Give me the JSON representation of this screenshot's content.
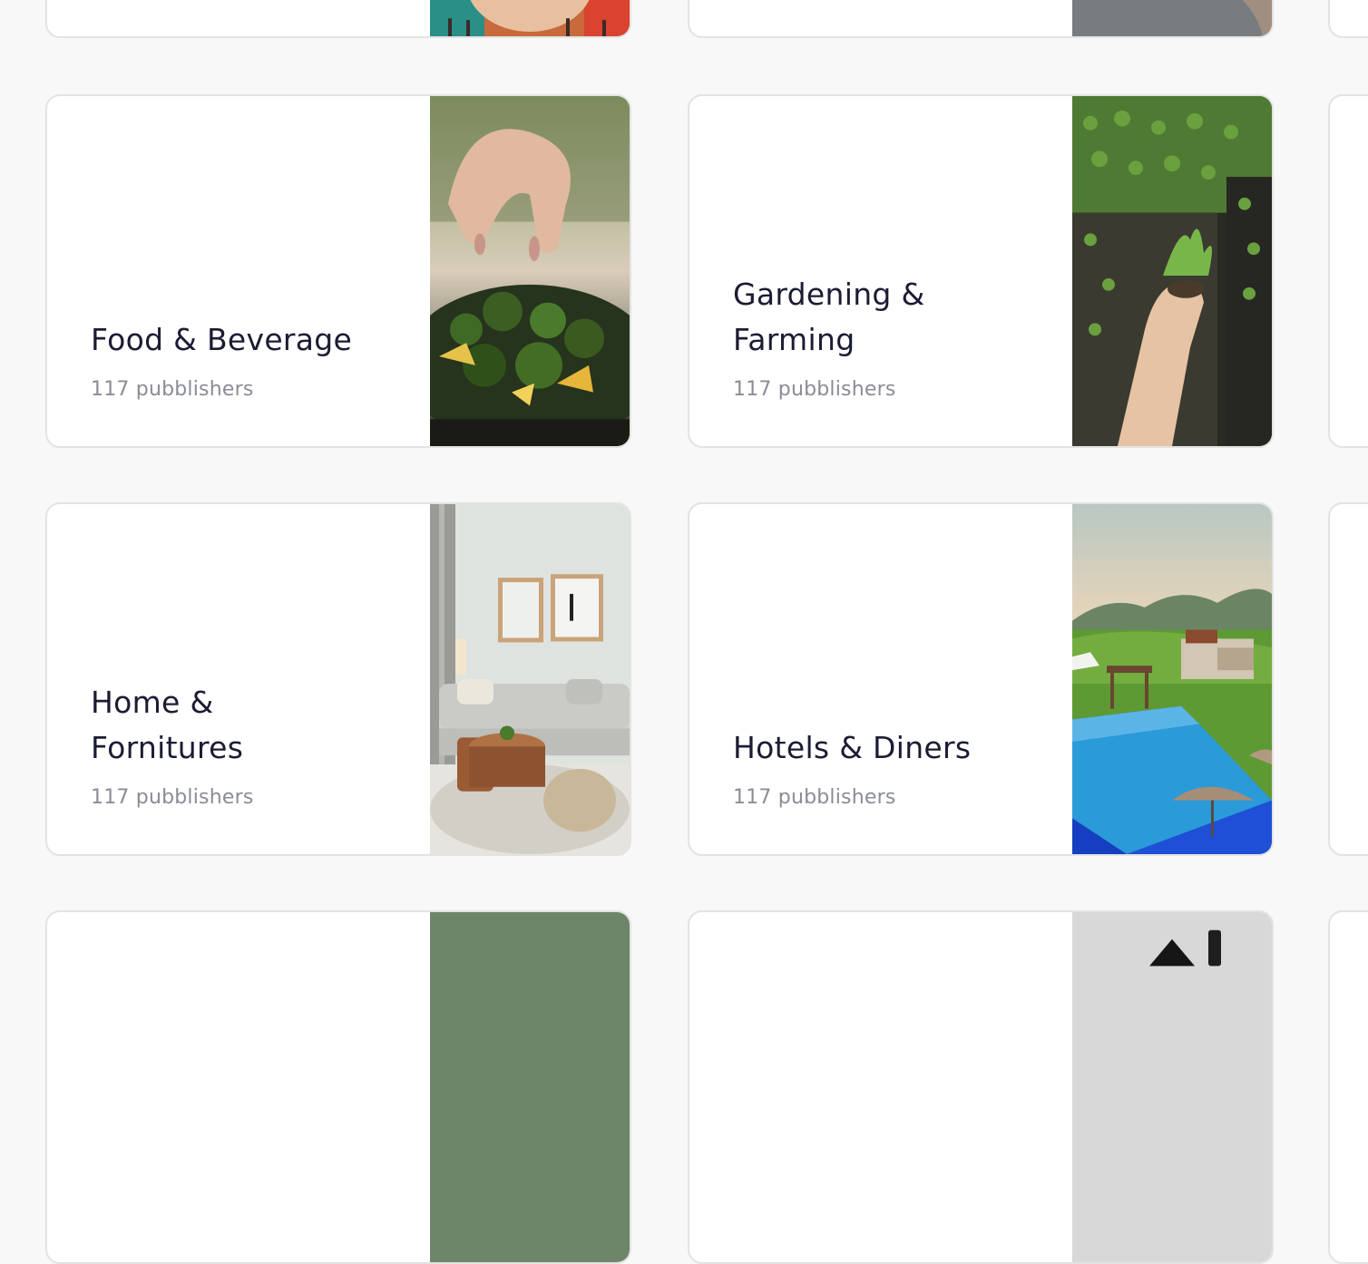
{
  "categories": [
    {
      "title": "Food & Beverage",
      "count": "117 pubblishers",
      "image": "food-photo"
    },
    {
      "title": "Gardening & Farming",
      "count": "117 pubblishers",
      "image": "gardening-photo"
    },
    {
      "title": "Home & Fornitures",
      "count": "117 pubblishers",
      "image": "living-room-photo"
    },
    {
      "title": "Hotels & Diners",
      "count": "117 pubblishers",
      "image": "hotel-pool-photo"
    }
  ],
  "colors": {
    "background": "#f8f8f8",
    "card": "#ffffff",
    "title": "#1b1c33",
    "count": "#8a8c96"
  }
}
